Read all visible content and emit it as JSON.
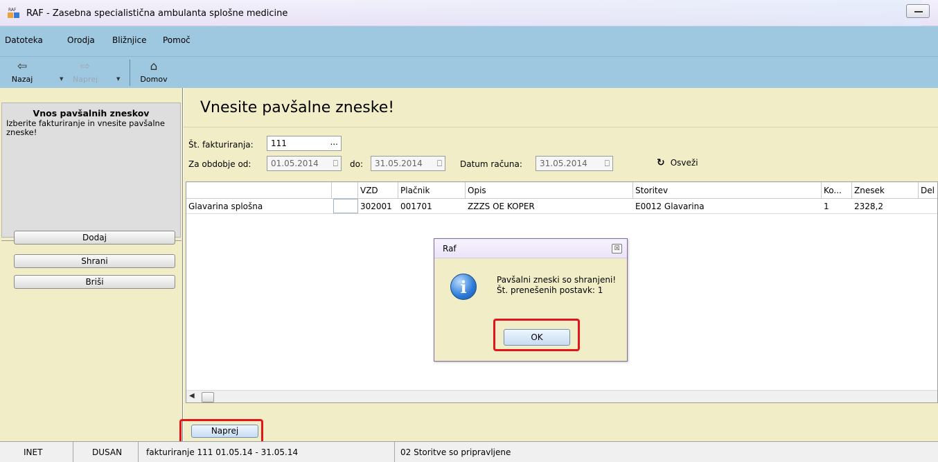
{
  "window": {
    "title": "RAF - Zasebna specialistična ambulanta splošne medicine"
  },
  "menu": [
    "Datoteka",
    "Orodja",
    "Bližnjice",
    "Pomoč"
  ],
  "toolbar": {
    "back_label": "Nazaj",
    "forward_label": "Naprej",
    "home_label": "Domov"
  },
  "left_panel": {
    "info_title": "Vnos pavšalnih zneskov",
    "info_desc": "Izberite fakturiranje in vnesite pavšalne zneske!",
    "buttons": [
      "Dodaj",
      "Shrani",
      "Briši"
    ]
  },
  "main": {
    "page_title": "Vnesite pavšalne zneske!",
    "filters": {
      "invoice_no_label": "Št. fakturiranja:",
      "invoice_no_value": "111",
      "invoice_no_picker": "...",
      "period_from_label": "Za obdobje od:",
      "period_from_value": "01.05.2014",
      "period_to_label": "do:",
      "period_to_value": "31.05.2014",
      "invoice_date_label": "Datum računa:",
      "invoice_date_value": "31.05.2014",
      "refresh_label": "Osveži"
    },
    "grid": {
      "columns": [
        "",
        "",
        "VZD",
        "Plačnik",
        "Opis",
        "Storitev",
        "Ko...",
        "Znesek",
        "Del"
      ],
      "rows": [
        [
          "Glavarina splošna",
          "",
          "302001",
          "001701",
          "ZZZS OE KOPER",
          "E0012 Glavarina",
          "1",
          "2328,2",
          ""
        ]
      ]
    },
    "next_button": "Naprej"
  },
  "dialog": {
    "title": "Raf",
    "close_glyph": "☒",
    "message_line1": "Pavšalni zneski so shranjeni!",
    "message_line2": "Št. prenešenih postavk: 1",
    "ok_label": "OK"
  },
  "statusbar": [
    "INET",
    "DUSAN",
    "fakturiranje 111  01.05.14 - 31.05.14",
    "02 Storitve so pripravljene"
  ],
  "colors": {
    "menu_bg": "#9ec8e0",
    "panel_bg": "#f1eec7",
    "highlight": "#e4141b",
    "dialog_border": "#7f6aa3"
  },
  "icons": {
    "back": "left-arrow-icon",
    "forward": "right-arrow-icon",
    "home": "home-icon",
    "refresh": "refresh-icon",
    "info": "info-icon",
    "calendar": "calendar-icon"
  }
}
